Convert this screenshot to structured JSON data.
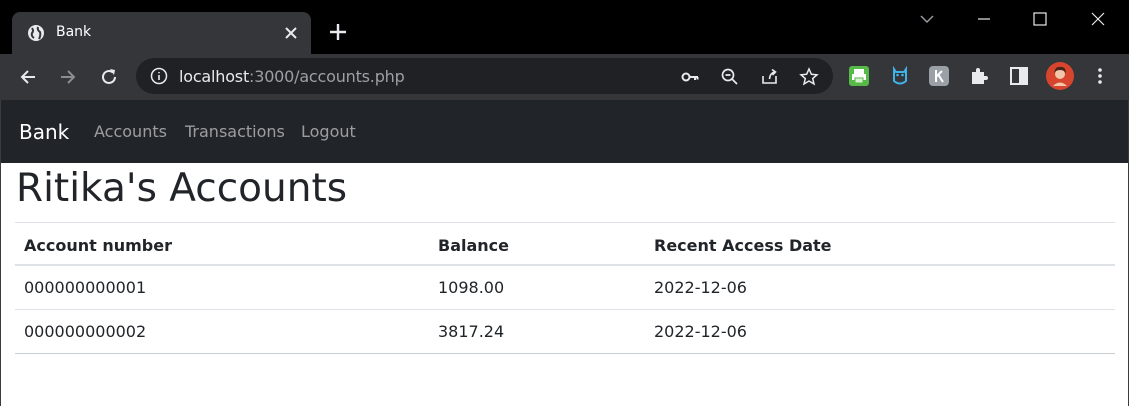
{
  "browser": {
    "tab_title": "Bank",
    "url_host": "localhost",
    "url_path": ":3000/accounts.php",
    "icons": [
      "globe-icon",
      "close-icon",
      "plus-icon",
      "chevron-down-icon",
      "minimize-icon",
      "maximize-icon",
      "window-close-icon",
      "back-icon",
      "forward-icon",
      "reload-icon",
      "info-icon",
      "key-icon",
      "zoom-out-icon",
      "share-icon",
      "star-icon",
      "printer-extension-icon",
      "owl-extension-icon",
      "k-extension-icon",
      "puzzle-icon",
      "sidepanel-icon",
      "avatar",
      "more-icon"
    ],
    "colors": {
      "titlebar": "#000000",
      "toolbar": "#35363a",
      "omnibox": "#202124"
    }
  },
  "navbar": {
    "brand": "Bank",
    "links": [
      "Accounts",
      "Transactions",
      "Logout"
    ],
    "color": "#212529"
  },
  "page": {
    "heading": "Ritika's Accounts",
    "table": {
      "headers": [
        "Account number",
        "Balance",
        "Recent Access Date"
      ],
      "rows": [
        [
          "000000000001",
          "1098.00",
          "2022-12-06"
        ],
        [
          "000000000002",
          "3817.24",
          "2022-12-06"
        ]
      ]
    }
  }
}
